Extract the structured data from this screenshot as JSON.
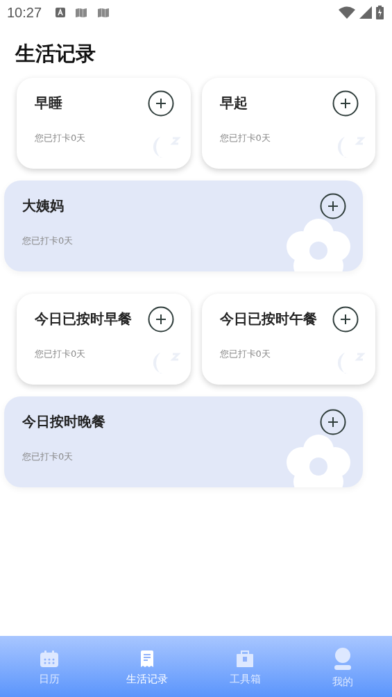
{
  "status_bar": {
    "time": "10:27"
  },
  "title": "生活记录",
  "groups": [
    {
      "cards": [
        {
          "kind": "sleep",
          "title": "早睡",
          "subtitle": "您已打卡0天"
        },
        {
          "kind": "sleep",
          "title": "早起",
          "subtitle": "您已打卡0天"
        },
        {
          "kind": "flower",
          "title": "大姨妈",
          "subtitle": "您已打卡0天"
        }
      ]
    },
    {
      "cards": [
        {
          "kind": "sleep",
          "title": "今日已按时早餐",
          "subtitle": "您已打卡0天"
        },
        {
          "kind": "sleep",
          "title": "今日已按时午餐",
          "subtitle": "您已打卡0天"
        },
        {
          "kind": "flower",
          "title": "今日按时晚餐",
          "subtitle": "您已打卡0天"
        }
      ]
    }
  ],
  "tab_bar": [
    {
      "label": "日历",
      "selected": false
    },
    {
      "label": "生活记录",
      "selected": true
    },
    {
      "label": "工具箱",
      "selected": false
    },
    {
      "label": "我的",
      "selected": false
    }
  ]
}
